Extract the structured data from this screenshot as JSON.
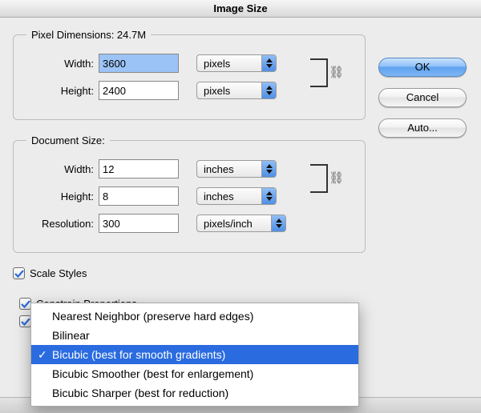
{
  "title": "Image Size",
  "pixel_dimensions": {
    "legend": "Pixel Dimensions:  24.7M",
    "width_label": "Width:",
    "width_value": "3600",
    "width_unit": "pixels",
    "height_label": "Height:",
    "height_value": "2400",
    "height_unit": "pixels"
  },
  "document_size": {
    "legend": "Document Size:",
    "width_label": "Width:",
    "width_value": "12",
    "width_unit": "inches",
    "height_label": "Height:",
    "height_value": "8",
    "height_unit": "inches",
    "resolution_label": "Resolution:",
    "resolution_value": "300",
    "resolution_unit": "pixels/inch"
  },
  "checks": {
    "scale_styles": "Scale Styles",
    "constrain": "Constrain Proportions"
  },
  "buttons": {
    "ok": "OK",
    "cancel": "Cancel",
    "auto": "Auto..."
  },
  "resample_menu": {
    "items": [
      "Nearest Neighbor (preserve hard edges)",
      "Bilinear",
      "Bicubic (best for smooth gradients)",
      "Bicubic Smoother (best for enlargement)",
      "Bicubic Sharper (best for reduction)"
    ],
    "selected_index": 2
  }
}
